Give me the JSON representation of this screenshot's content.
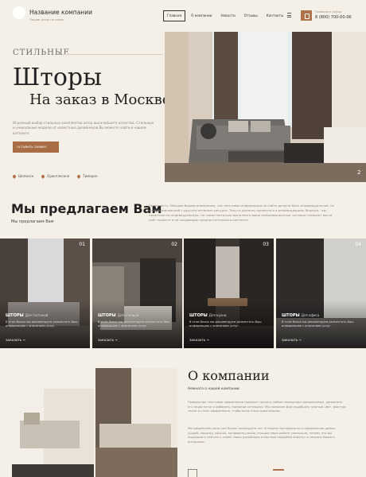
{
  "header": {
    "company_name": "Название компании",
    "company_sub": "Пошив штор на заказ",
    "nav": [
      "Главная",
      "О компании",
      "Новости",
      "Отзывы",
      "Контакты"
    ],
    "phone_label": "Позвоните сейчас",
    "phone": "8 (800) 700-00-00",
    "icons": {
      "menu": "menu-icon",
      "phone": "phone-icon",
      "chevron": "chevron-down-icon"
    }
  },
  "hero": {
    "eyebrow": "СТИЛЬНЫЕ",
    "title": "Шторы",
    "title2": "На заказ в Москве",
    "description": "Огромный выбор стильных комплектов штор высочайшего качества. Стильные и уникальные модели от известных дизайнеров Вы можете найти в нашем каталоге.",
    "cta": "ОСТАВИТЬ ЗАЯВКУ",
    "cities": [
      "Шопинск",
      "Оракплесино",
      "Тимерин"
    ],
    "slide_num": "2"
  },
  "offers": {
    "title": "Мы предлагаем Вам",
    "subtitle": "Мы предлагаем Вам",
    "description": "Полезность. Обещаю Вашим вниманием, что текстовая информация на сайте должна быть индивидуальной, не оптимизированной с другого интернет-ресурса. Тексты должны грамотно и в рекомендациях Яндекса - вы гарантию на индивидуальную, не самостоятельно выполнять ваши информационные, которые поможет вести сайт проекте и не создающие предпочтительного контента.",
    "cards": [
      {
        "num": "01",
        "title": "ШТОРЫ",
        "tag": "Для гостиной",
        "text": "В этом блоке мы рекомендуем разместить Ваш информацию с описанием услуг.",
        "link": "ЗАКАЗАТЬ"
      },
      {
        "num": "02",
        "title": "ШТОРЫ",
        "tag": "Для спальни",
        "text": "В этом блоке мы рекомендуем разместить Ваш информацию с описанием услуг.",
        "link": "ЗАКАЗАТЬ"
      },
      {
        "num": "03",
        "title": "ШТОРЫ",
        "tag": "Для кухни",
        "text": "В этом блоке мы рекомендуем разместить Ваш информацию с описанием услуг.",
        "link": "ЗАКАЗАТЬ"
      },
      {
        "num": "04",
        "title": "ШТОРЫ",
        "tag": "Для офиса",
        "text": "В этом блоке мы рекомендуем разместить Ваш информацию с описанием услуг.",
        "link": "ЗАКАЗАТЬ"
      }
    ]
  },
  "about": {
    "title": "О компании",
    "subtitle": "Немного о нашей компании",
    "p1": "Правильное текстовое оформление поможет сделать любое помещение совершенным, дополнить его недостатки и добавить гармонии интерьеру. Мы поможем Вам подобрать нужный цвет, фактуру ткани и стиль оформления, чтобы окна стали идеальными.",
    "p2": "Мы оформляем окна уже более тринадцати лет. В нашем портфолио есть оформление домов, усадеб, квартир, офисов, конференц-залов, каждая наша работа уникальна, потому что мы подходим к ней как к своей. Наши дизайнеры и мастера подробно вникнут в запросы Вашего интерьера."
  }
}
